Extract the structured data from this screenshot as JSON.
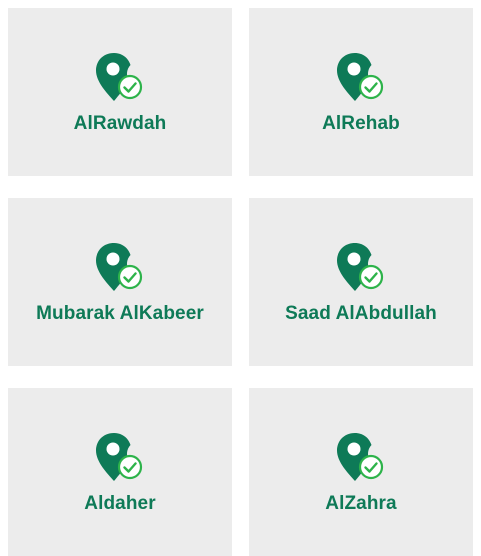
{
  "colors": {
    "card_background": "#ececec",
    "pin": "#0e7a57",
    "check_badge": "#2db34a",
    "label": "#0e7a57"
  },
  "areas": [
    {
      "name": "AlRawdah",
      "icon": "location-check-icon"
    },
    {
      "name": "AlRehab",
      "icon": "location-check-icon"
    },
    {
      "name": "Mubarak AlKabeer",
      "icon": "location-check-icon"
    },
    {
      "name": "Saad AlAbdullah",
      "icon": "location-check-icon"
    },
    {
      "name": "Aldaher",
      "icon": "location-check-icon"
    },
    {
      "name": "AlZahra",
      "icon": "location-check-icon"
    }
  ]
}
